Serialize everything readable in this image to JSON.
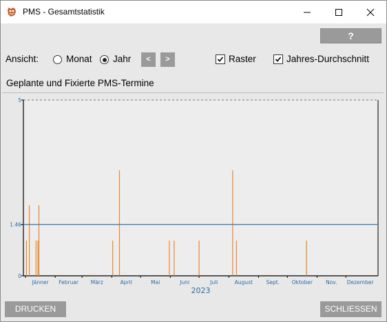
{
  "window": {
    "title": "PMS - Gesamtstatistik"
  },
  "toolbar": {
    "help_label": "?",
    "view_label": "Ansicht:",
    "radio_month": "Monat",
    "radio_year": "Jahr",
    "selected_view": "Jahr",
    "prev_label": "<",
    "next_label": ">",
    "grid_label": "Raster",
    "grid_checked": true,
    "avg_label": "Jahres-Durchschnitt",
    "avg_checked": true
  },
  "section": {
    "title": "Geplante und Fixierte PMS-Termine"
  },
  "colors": {
    "bar": "#e8872a",
    "average": "#3b7db5",
    "axis_label": "#2a6aa8"
  },
  "chart_data": {
    "type": "bar",
    "title": "",
    "xlabel": "2023",
    "ylabel": "",
    "ylim": [
      0,
      5
    ],
    "ytick_labels": [
      "0",
      "1.46",
      "5"
    ],
    "average": 1.46,
    "month_labels": [
      "Jänner",
      "Februar",
      "März",
      "April",
      "Mai",
      "Juni",
      "Juli",
      "August",
      "Sept.",
      "Oktober",
      "Nov.",
      "Dezember"
    ],
    "x_unit": "day of year",
    "xlim": [
      1,
      365
    ],
    "bars": [
      {
        "day": 2,
        "value": 1
      },
      {
        "day": 5,
        "value": 2
      },
      {
        "day": 12,
        "value": 1
      },
      {
        "day": 14,
        "value": 1
      },
      {
        "day": 15,
        "value": 2
      },
      {
        "day": 92,
        "value": 1
      },
      {
        "day": 99,
        "value": 3
      },
      {
        "day": 151,
        "value": 1
      },
      {
        "day": 156,
        "value": 1
      },
      {
        "day": 182,
        "value": 1
      },
      {
        "day": 217,
        "value": 3
      },
      {
        "day": 221,
        "value": 1
      },
      {
        "day": 294,
        "value": 1
      }
    ]
  },
  "footer": {
    "print_label": "DRUCKEN",
    "close_label": "SCHLIESSEN"
  }
}
